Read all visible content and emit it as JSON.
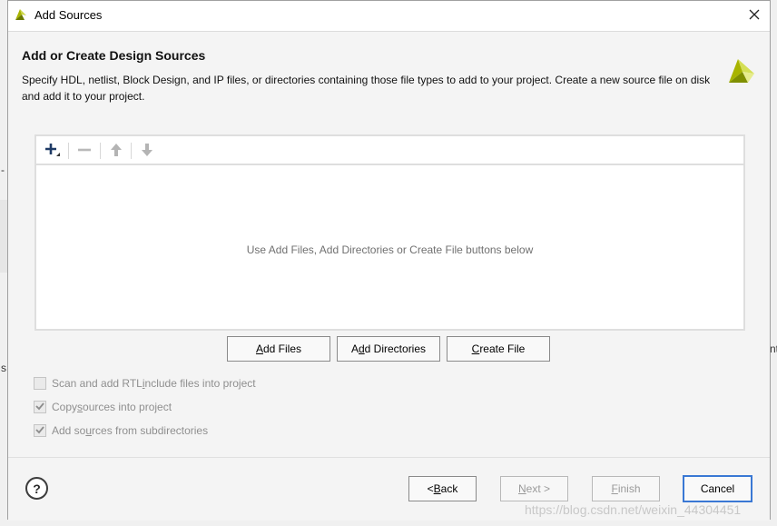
{
  "window": {
    "title": "Add Sources",
    "close_glyph": "✕"
  },
  "page": {
    "heading": "Add or Create Design Sources",
    "description": "Specify HDL, netlist, Block Design, and IP files, or directories containing those file types to add to your project. Create a new source file on disk and add it to your project."
  },
  "file_panel": {
    "empty_message": "Use Add Files, Add Directories or Create File buttons below"
  },
  "toolbar": {
    "add_glyph": "+",
    "remove_glyph": "—",
    "up_glyph": "⬆",
    "down_glyph": "⬇"
  },
  "buttons": {
    "add_files": {
      "pre": "",
      "mnemonic": "A",
      "post": "dd Files"
    },
    "add_directories": {
      "pre": "A",
      "mnemonic": "d",
      "post": "d Directories"
    },
    "create_file": {
      "pre": "",
      "mnemonic": "C",
      "post": "reate File"
    }
  },
  "options": [
    {
      "pre": "Scan and add RTL ",
      "mnemonic": "i",
      "post": "nclude files into project",
      "checked": false
    },
    {
      "pre": "Copy ",
      "mnemonic": "s",
      "post": "ources into project",
      "checked": true
    },
    {
      "pre": "Add so",
      "mnemonic": "u",
      "post": "rces from subdirectories",
      "checked": true
    }
  ],
  "footer": {
    "help": "?",
    "back": {
      "pre": "< ",
      "mnemonic": "B",
      "post": "ack"
    },
    "next": {
      "pre": "",
      "mnemonic": "N",
      "post": "ext >"
    },
    "finish": {
      "pre": "",
      "mnemonic": "F",
      "post": "inish"
    },
    "cancel": "Cancel"
  },
  "background": {
    "fragment_left": "s",
    "fragment_right": "nt",
    "fragment_dash": "-"
  },
  "watermark": "https://blog.csdn.net/weixin_44304451",
  "colors": {
    "accent": "#3a78d4",
    "logo_green": "#a8b400",
    "logo_dark": "#6b7a00"
  }
}
